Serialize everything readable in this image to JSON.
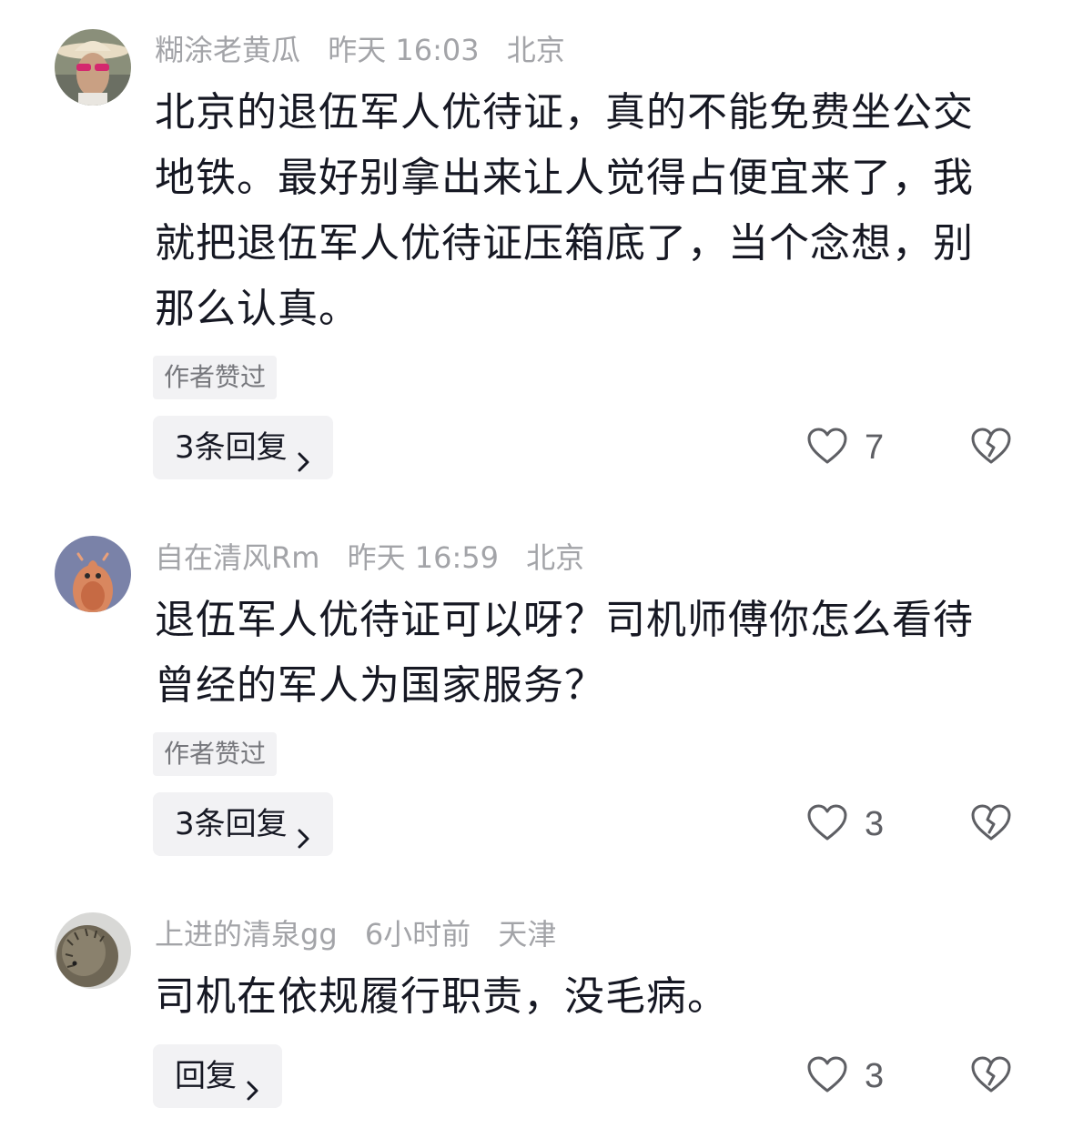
{
  "comments": [
    {
      "username": "糊涂老黄瓜",
      "time": "昨天 16:03",
      "location": "北京",
      "text": "北京的退伍军人优待证，真的不能免费坐公交地铁。最好别拿出来让人觉得占便宜来了，我就把退伍军人优待证压箱底了，当个念想，别那么认真。",
      "author_liked": "作者赞过",
      "reply_label": "3条回复",
      "likes": "7"
    },
    {
      "username": "自在清风Rm",
      "time": "昨天 16:59",
      "location": "北京",
      "text": "退伍军人优待证可以呀？司机师傅你怎么看待曾经的军人为国家服务？",
      "author_liked": "作者赞过",
      "reply_label": "3条回复",
      "likes": "3"
    },
    {
      "username": "上进的清泉gg",
      "time": "6小时前",
      "location": "天津",
      "text": "司机在依规履行职责，没毛病。",
      "reply_label": "回复",
      "likes": "3"
    }
  ],
  "icons": {
    "like": "heart-outline-icon",
    "dislike": "broken-heart-icon",
    "chevron": "chevron-right-icon"
  },
  "colors": {
    "meta": "#a3a4a8",
    "text": "#161823",
    "button_bg": "#f2f2f4"
  }
}
